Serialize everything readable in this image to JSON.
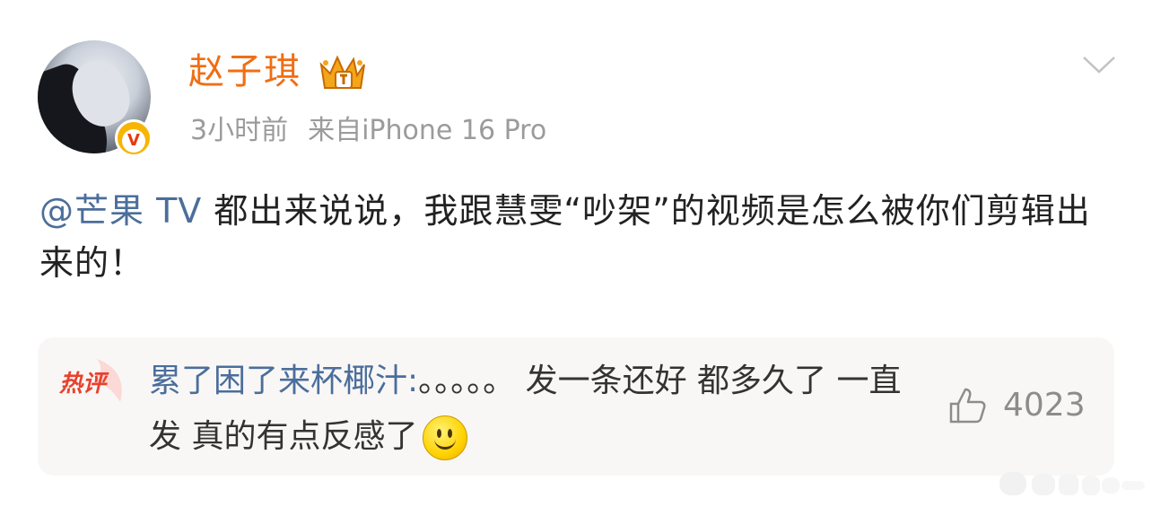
{
  "post": {
    "author": {
      "name": "赵子琪",
      "verified_badge": "v-badge-icon",
      "member_crown": "crown-icon"
    },
    "meta": {
      "time": "3小时前",
      "source": "来自iPhone 16 Pro"
    },
    "content": {
      "mention": "@芒果 TV",
      "text": " 都出来说说，我跟慧雯“吵架”的视频是怎么被你们剪辑出来的！"
    },
    "menu_icon": "chevron-down-icon"
  },
  "hot_comment": {
    "tag": "热评",
    "user": "累了困了来杯椰汁",
    "separator": ":",
    "text": "。。。。。 发一条还好 都多久了 一直发 真的有点反感了",
    "emoji": "smile-emoji-icon",
    "like_count": "4023",
    "like_icon": "thumbs-up-icon"
  },
  "colors": {
    "username": "#f06e13",
    "link": "#4b6e9b",
    "meta": "#9b9b9b",
    "hot_tag": "#e8412c",
    "comment_bg": "#f9f7f6"
  }
}
